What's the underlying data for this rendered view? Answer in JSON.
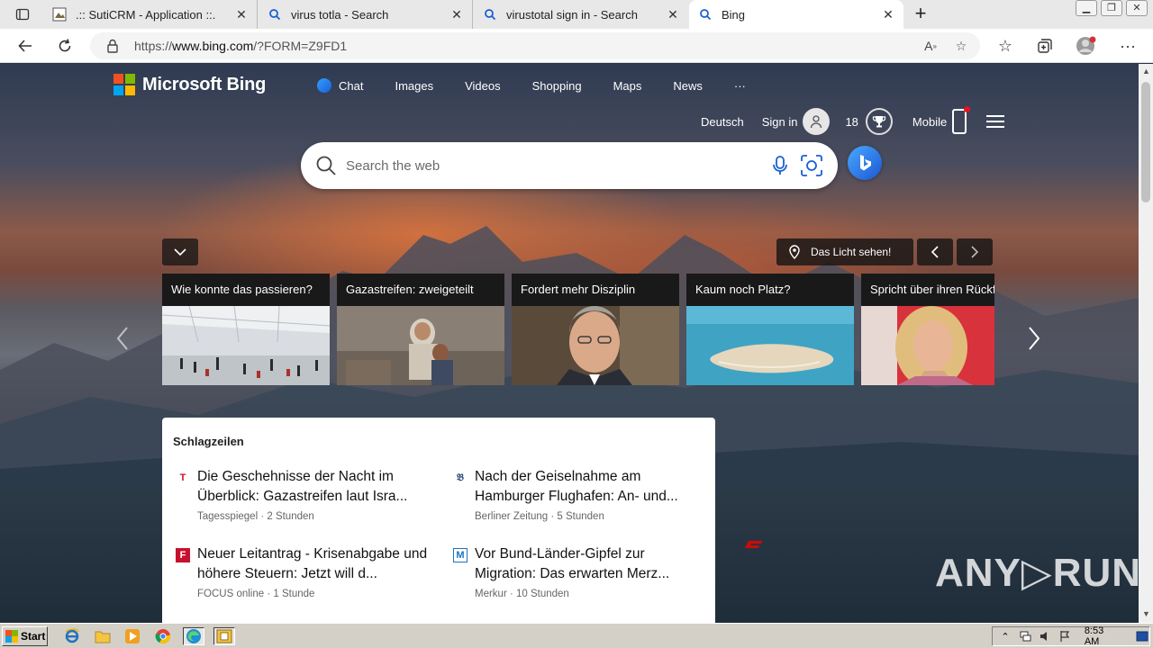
{
  "browser": {
    "tabs": [
      {
        "title": ".:: SutiCRM - Application ::.",
        "icon": "page-icon"
      },
      {
        "title": "virus totla - Search",
        "icon": "search-icon"
      },
      {
        "title": "virustotal sign in - Search",
        "icon": "search-icon"
      },
      {
        "title": "Bing",
        "icon": "search-icon"
      }
    ],
    "url_prefix": "https://",
    "url_host": "www.bing.com",
    "url_path": "/?FORM=Z9FD1"
  },
  "bing": {
    "logo_text": "Microsoft Bing",
    "nav": [
      "Chat",
      "Images",
      "Videos",
      "Shopping",
      "Maps",
      "News",
      "···"
    ],
    "language": "Deutsch",
    "sign_in": "Sign in",
    "points": "18",
    "mobile": "Mobile",
    "search_placeholder": "Search the web",
    "location_label": "Das Licht sehen!"
  },
  "carousel": [
    {
      "title": "Wie konnte das passieren?",
      "image": "airport-hall"
    },
    {
      "title": "Gazastreifen: zweigeteilt",
      "image": "child-in-rubble"
    },
    {
      "title": "Fordert mehr Disziplin",
      "image": "politician-portrait"
    },
    {
      "title": "Kaum noch Platz?",
      "image": "sandbank-in-sea"
    },
    {
      "title": "Spricht über ihren Rückf",
      "image": "blonde-woman-portrait"
    }
  ],
  "news": {
    "heading": "Schlagzeilen",
    "articles": [
      {
        "title": "Die Geschehnisse der Nacht im Überblick: Gazastreifen laut Isra...",
        "meta": "Tagesspiegel · 2 Stunden",
        "source_icon": "T",
        "icon_color": "#c8102e"
      },
      {
        "title": "Nach der Geiselnahme am Hamburger Flughafen: An- und...",
        "meta": "Berliner Zeitung · 5 Stunden",
        "source_icon": "𝔅",
        "icon_color": "#1a3a6b"
      },
      {
        "title": "Neuer Leitantrag - Krisenabgabe und höhere Steuern: Jetzt will d...",
        "meta": "FOCUS online · 1 Stunde",
        "source_icon": "F",
        "icon_color": "#c8102e"
      },
      {
        "title": "Vor Bund-Länder-Gipfel zur Migration: Das erwarten Merz...",
        "meta": "Merkur · 10 Stunden",
        "source_icon": "M",
        "icon_color": "#1e73be"
      }
    ]
  },
  "watermark": "ANY▷RUN",
  "taskbar": {
    "start": "Start",
    "clock": "8:53 AM"
  },
  "colors": {
    "logo_red": "#f25022",
    "logo_green": "#7fba00",
    "logo_blue": "#00a4ef",
    "logo_yellow": "#ffb900",
    "taskbar": "#d4d0c8"
  }
}
